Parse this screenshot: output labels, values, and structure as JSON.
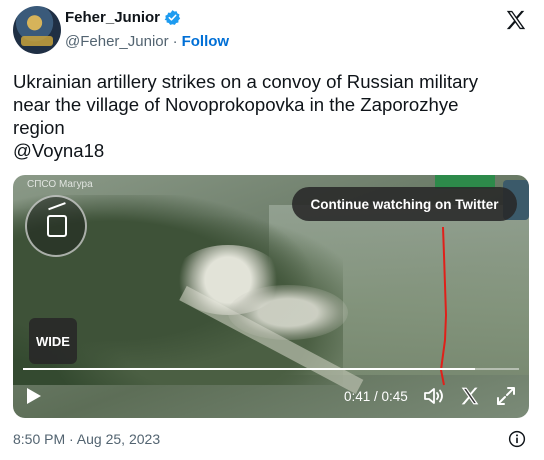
{
  "author": {
    "display_name": "Feher_Junior",
    "handle": "@Feher_Junior",
    "separator": "·",
    "follow_label": "Follow",
    "verified_color": "#1d9bf0"
  },
  "tweet": {
    "lines": [
      "Ukrainian artillery strikes on a convoy of Russian military",
      "near the village of Novoprokopovka in the Zaporozhye",
      "region",
      "@Voyna18"
    ]
  },
  "video": {
    "watermark": "СПСО Магура",
    "badge": "WIDE",
    "continue_label": "Continue watching on Twitter",
    "time_display": "0:41 / 0:45",
    "progress_fraction": 0.911
  },
  "footer": {
    "timestamp": "8:50 PM · Aug 25, 2023"
  },
  "icons": {
    "brand": "x-logo-icon",
    "play": "play-icon",
    "volume": "volume-icon",
    "close": "x-close-icon",
    "fullscreen": "fullscreen-icon",
    "info": "info-icon"
  }
}
